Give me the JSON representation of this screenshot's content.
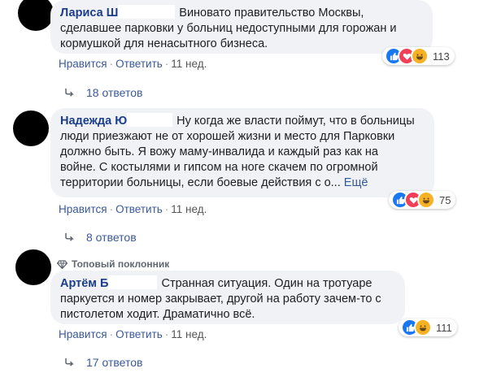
{
  "comments": [
    {
      "author": "Лариса Ш",
      "text": "Виновато правительство Москвы, сделавшее парковки у больниц недоступными для горожан и кормушкой для ненасытного бизнеса.",
      "line1": "Виновато правительство Москвы,",
      "line2": "сделавшее парковки у больниц недоступными для горожан и",
      "line3": "кормушкой для ненасытного бизнеса.",
      "like_label": "Нравится",
      "reply_label": "Ответить",
      "time": "11 нед.",
      "reactions": [
        "like",
        "love",
        "haha"
      ],
      "reaction_count": "113",
      "replies_label": "18 ответов"
    },
    {
      "author": "Надежда Ю",
      "line1": "Ну когда же власти поймут, что в больницы",
      "line2": "люди приезжают не от хорошей жизни и место для Парковки",
      "line3": "должно быть. Я вожу маму-инвалида и каждый раз как на",
      "line4": "войне. С костылями и гипсом на ноге скачем по огромной",
      "line5": "территории больницы, если боевые действия с о...",
      "more_label": "Ещё",
      "like_label": "Нравится",
      "reply_label": "Ответить",
      "time": "11 нед.",
      "reactions": [
        "like",
        "love",
        "haha"
      ],
      "reaction_count": "75",
      "replies_label": "8 ответов"
    },
    {
      "badge": "Топовый поклонник",
      "author": "Артём Б",
      "line1": "Странная ситуация. Один на тротуаре",
      "line2": "паркуется и номер закрывает, другой на работу зачем-то с",
      "line3": "пистолетом ходит. Драматично всё.",
      "like_label": "Нравится",
      "reply_label": "Ответить",
      "time": "11 нед.",
      "reactions": [
        "like",
        "haha"
      ],
      "reaction_count": "111",
      "replies_label": "17 ответов"
    }
  ],
  "separator": "·",
  "colors": {
    "author": "#1c3e8a",
    "link": "#3b5998",
    "bubble": "#f0f2f5",
    "like": "#1877f2",
    "love": "#f33e58",
    "haha": "#f7b125"
  }
}
